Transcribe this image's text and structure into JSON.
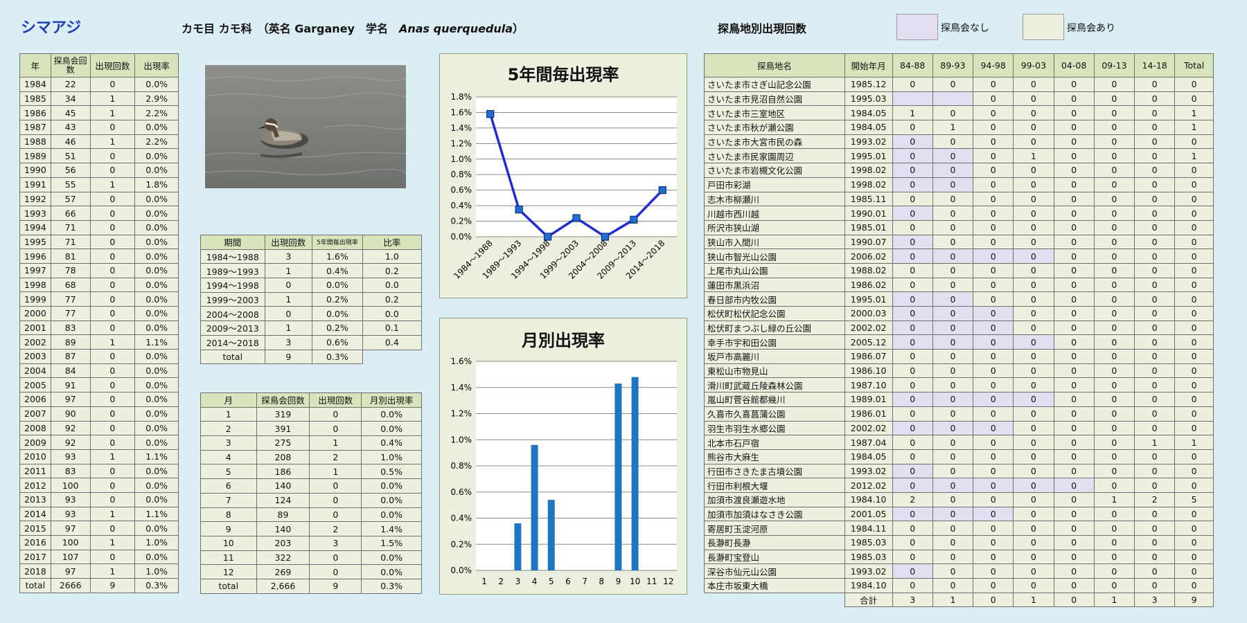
{
  "header": {
    "title": "シマアジ",
    "family": "カモ目 カモ科",
    "english_label": "（英名",
    "english_name": "Garganey",
    "scientific_label": "学名",
    "scientific_name": "Anas querquedula",
    "close_paren": "）",
    "site_heading": "探鳥地別出現回数",
    "legend_none": "探鳥会なし",
    "legend_yes": "探鳥会あり"
  },
  "colors": {
    "shade_none": "#e4dff0",
    "shade_yes": "#ebf1de",
    "series": "#1f2bd6",
    "bar": "#1f74c4",
    "title_blue": "#1f3fbf"
  },
  "year_table": {
    "headers": [
      "年",
      "探鳥会回数",
      "出現回数",
      "出現率"
    ],
    "rows": [
      [
        "1984",
        "22",
        "0",
        "0.0%"
      ],
      [
        "1985",
        "34",
        "1",
        "2.9%"
      ],
      [
        "1986",
        "45",
        "1",
        "2.2%"
      ],
      [
        "1987",
        "43",
        "0",
        "0.0%"
      ],
      [
        "1988",
        "46",
        "1",
        "2.2%"
      ],
      [
        "1989",
        "51",
        "0",
        "0.0%"
      ],
      [
        "1990",
        "56",
        "0",
        "0.0%"
      ],
      [
        "1991",
        "55",
        "1",
        "1.8%"
      ],
      [
        "1992",
        "57",
        "0",
        "0.0%"
      ],
      [
        "1993",
        "66",
        "0",
        "0.0%"
      ],
      [
        "1994",
        "71",
        "0",
        "0.0%"
      ],
      [
        "1995",
        "71",
        "0",
        "0.0%"
      ],
      [
        "1996",
        "81",
        "0",
        "0.0%"
      ],
      [
        "1997",
        "78",
        "0",
        "0.0%"
      ],
      [
        "1998",
        "68",
        "0",
        "0.0%"
      ],
      [
        "1999",
        "77",
        "0",
        "0.0%"
      ],
      [
        "2000",
        "77",
        "0",
        "0.0%"
      ],
      [
        "2001",
        "83",
        "0",
        "0.0%"
      ],
      [
        "2002",
        "89",
        "1",
        "1.1%"
      ],
      [
        "2003",
        "87",
        "0",
        "0.0%"
      ],
      [
        "2004",
        "84",
        "0",
        "0.0%"
      ],
      [
        "2005",
        "91",
        "0",
        "0.0%"
      ],
      [
        "2006",
        "97",
        "0",
        "0.0%"
      ],
      [
        "2007",
        "90",
        "0",
        "0.0%"
      ],
      [
        "2008",
        "92",
        "0",
        "0.0%"
      ],
      [
        "2009",
        "92",
        "0",
        "0.0%"
      ],
      [
        "2010",
        "93",
        "1",
        "1.1%"
      ],
      [
        "2011",
        "83",
        "0",
        "0.0%"
      ],
      [
        "2012",
        "100",
        "0",
        "0.0%"
      ],
      [
        "2013",
        "93",
        "0",
        "0.0%"
      ],
      [
        "2014",
        "93",
        "1",
        "1.1%"
      ],
      [
        "2015",
        "97",
        "0",
        "0.0%"
      ],
      [
        "2016",
        "100",
        "1",
        "1.0%"
      ],
      [
        "2017",
        "107",
        "0",
        "0.0%"
      ],
      [
        "2018",
        "97",
        "1",
        "1.0%"
      ]
    ],
    "total": [
      "total",
      "2666",
      "9",
      "0.3%"
    ]
  },
  "period_table": {
    "headers": [
      "期間",
      "出現回数",
      "5年間毎出現率",
      "比率"
    ],
    "rows": [
      [
        "1984～1988",
        "3",
        "1.6%",
        "1.0"
      ],
      [
        "1989～1993",
        "1",
        "0.4%",
        "0.2"
      ],
      [
        "1994～1998",
        "0",
        "0.0%",
        "0.0"
      ],
      [
        "1999～2003",
        "1",
        "0.2%",
        "0.2"
      ],
      [
        "2004～2008",
        "0",
        "0.0%",
        "0.0"
      ],
      [
        "2009～2013",
        "1",
        "0.2%",
        "0.1"
      ],
      [
        "2014～2018",
        "3",
        "0.6%",
        "0.4"
      ]
    ],
    "total": [
      "total",
      "9",
      "0.3%"
    ]
  },
  "month_table": {
    "headers": [
      "月",
      "探鳥会回数",
      "出現回数",
      "月別出現率"
    ],
    "rows": [
      [
        "1",
        "319",
        "0",
        "0.0%"
      ],
      [
        "2",
        "391",
        "0",
        "0.0%"
      ],
      [
        "3",
        "275",
        "1",
        "0.4%"
      ],
      [
        "4",
        "208",
        "2",
        "1.0%"
      ],
      [
        "5",
        "186",
        "1",
        "0.5%"
      ],
      [
        "6",
        "140",
        "0",
        "0.0%"
      ],
      [
        "7",
        "124",
        "0",
        "0.0%"
      ],
      [
        "8",
        "89",
        "0",
        "0.0%"
      ],
      [
        "9",
        "140",
        "2",
        "1.4%"
      ],
      [
        "10",
        "203",
        "3",
        "1.5%"
      ],
      [
        "11",
        "322",
        "0",
        "0.0%"
      ],
      [
        "12",
        "269",
        "0",
        "0.0%"
      ]
    ],
    "total": [
      "total",
      "2,666",
      "9",
      "0.3%"
    ]
  },
  "site_table": {
    "headers": [
      "探鳥地名",
      "開始年月",
      "84-88",
      "89-93",
      "94-98",
      "99-03",
      "04-08",
      "09-13",
      "14-18",
      "Total"
    ],
    "rows": [
      {
        "name": "さいたま市さぎ山記念公園",
        "start": "1985.12",
        "v": [
          "0",
          "0",
          "0",
          "0",
          "0",
          "0",
          "0",
          "0"
        ],
        "shade": []
      },
      {
        "name": "さいたま市見沼自然公園",
        "start": "1995.03",
        "v": [
          "",
          "",
          "0",
          "0",
          "0",
          "0",
          "0",
          "0"
        ],
        "shade": [
          0,
          1
        ]
      },
      {
        "name": "さいたま市三室地区",
        "start": "1984.05",
        "v": [
          "1",
          "0",
          "0",
          "0",
          "0",
          "0",
          "0",
          "1"
        ],
        "shade": []
      },
      {
        "name": "さいたま市秋が瀬公園",
        "start": "1984.05",
        "v": [
          "0",
          "1",
          "0",
          "0",
          "0",
          "0",
          "0",
          "1"
        ],
        "shade": []
      },
      {
        "name": "さいたま市大宮市民の森",
        "start": "1993.02",
        "v": [
          "0",
          "0",
          "0",
          "0",
          "0",
          "0",
          "0",
          "0"
        ],
        "shade": [
          0
        ]
      },
      {
        "name": "さいたま市民家園周辺",
        "start": "1995.01",
        "v": [
          "0",
          "0",
          "0",
          "1",
          "0",
          "0",
          "0",
          "1"
        ],
        "shade": [
          0,
          1
        ]
      },
      {
        "name": "さいたま市岩槻文化公園",
        "start": "1998.02",
        "v": [
          "0",
          "0",
          "0",
          "0",
          "0",
          "0",
          "0",
          "0"
        ],
        "shade": [
          0,
          1
        ]
      },
      {
        "name": "戸田市彩湖",
        "start": "1998.02",
        "v": [
          "0",
          "0",
          "0",
          "0",
          "0",
          "0",
          "0",
          "0"
        ],
        "shade": [
          0,
          1
        ]
      },
      {
        "name": "志木市柳瀬川",
        "start": "1985.11",
        "v": [
          "0",
          "0",
          "0",
          "0",
          "0",
          "0",
          "0",
          "0"
        ],
        "shade": []
      },
      {
        "name": "川越市西川越",
        "start": "1990.01",
        "v": [
          "0",
          "0",
          "0",
          "0",
          "0",
          "0",
          "0",
          "0"
        ],
        "shade": [
          0
        ]
      },
      {
        "name": "所沢市狭山湖",
        "start": "1985.01",
        "v": [
          "0",
          "0",
          "0",
          "0",
          "0",
          "0",
          "0",
          "0"
        ],
        "shade": []
      },
      {
        "name": "狭山市入間川",
        "start": "1990.07",
        "v": [
          "0",
          "0",
          "0",
          "0",
          "0",
          "0",
          "0",
          "0"
        ],
        "shade": [
          0
        ]
      },
      {
        "name": "狭山市智光山公園",
        "start": "2006.02",
        "v": [
          "0",
          "0",
          "0",
          "0",
          "0",
          "0",
          "0",
          "0"
        ],
        "shade": [
          0,
          1,
          2,
          3
        ]
      },
      {
        "name": "上尾市丸山公園",
        "start": "1988.02",
        "v": [
          "0",
          "0",
          "0",
          "0",
          "0",
          "0",
          "0",
          "0"
        ],
        "shade": []
      },
      {
        "name": "蓮田市黒浜沼",
        "start": "1986.02",
        "v": [
          "0",
          "0",
          "0",
          "0",
          "0",
          "0",
          "0",
          "0"
        ],
        "shade": []
      },
      {
        "name": "春日部市内牧公園",
        "start": "1995.01",
        "v": [
          "0",
          "0",
          "0",
          "0",
          "0",
          "0",
          "0",
          "0"
        ],
        "shade": [
          0,
          1
        ]
      },
      {
        "name": "松伏町松伏記念公園",
        "start": "2000.03",
        "v": [
          "0",
          "0",
          "0",
          "0",
          "0",
          "0",
          "0",
          "0"
        ],
        "shade": [
          0,
          1,
          2
        ]
      },
      {
        "name": "松伏町まつぶし緑の丘公園",
        "start": "2002.02",
        "v": [
          "0",
          "0",
          "0",
          "0",
          "0",
          "0",
          "0",
          "0"
        ],
        "shade": [
          0,
          1,
          2
        ]
      },
      {
        "name": "幸手市宇和田公園",
        "start": "2005.12",
        "v": [
          "0",
          "0",
          "0",
          "0",
          "0",
          "0",
          "0",
          "0"
        ],
        "shade": [
          0,
          1,
          2,
          3
        ]
      },
      {
        "name": "坂戸市高麗川",
        "start": "1986.07",
        "v": [
          "0",
          "0",
          "0",
          "0",
          "0",
          "0",
          "0",
          "0"
        ],
        "shade": []
      },
      {
        "name": "東松山市物見山",
        "start": "1986.10",
        "v": [
          "0",
          "0",
          "0",
          "0",
          "0",
          "0",
          "0",
          "0"
        ],
        "shade": []
      },
      {
        "name": "滑川町武蔵丘陵森林公園",
        "start": "1987.10",
        "v": [
          "0",
          "0",
          "0",
          "0",
          "0",
          "0",
          "0",
          "0"
        ],
        "shade": []
      },
      {
        "name": "嵐山町菅谷館都幾川",
        "start": "1989.01",
        "v": [
          "0",
          "0",
          "0",
          "0",
          "0",
          "0",
          "0",
          "0"
        ],
        "shade": [
          0,
          1,
          2,
          3
        ]
      },
      {
        "name": "久喜市久喜菖蒲公園",
        "start": "1986.01",
        "v": [
          "0",
          "0",
          "0",
          "0",
          "0",
          "0",
          "0",
          "0"
        ],
        "shade": []
      },
      {
        "name": "羽生市羽生水郷公園",
        "start": "2002.02",
        "v": [
          "0",
          "0",
          "0",
          "0",
          "0",
          "0",
          "0",
          "0"
        ],
        "shade": [
          0,
          1,
          2
        ]
      },
      {
        "name": "北本市石戸宿",
        "start": "1987.04",
        "v": [
          "0",
          "0",
          "0",
          "0",
          "0",
          "0",
          "1",
          "1"
        ],
        "shade": []
      },
      {
        "name": "熊谷市大麻生",
        "start": "1984.05",
        "v": [
          "0",
          "0",
          "0",
          "0",
          "0",
          "0",
          "0",
          "0"
        ],
        "shade": []
      },
      {
        "name": "行田市さきたま古墳公園",
        "start": "1993.02",
        "v": [
          "0",
          "0",
          "0",
          "0",
          "0",
          "0",
          "0",
          "0"
        ],
        "shade": [
          0
        ]
      },
      {
        "name": "行田市利根大堰",
        "start": "2012.02",
        "v": [
          "0",
          "0",
          "0",
          "0",
          "0",
          "0",
          "0",
          "0"
        ],
        "shade": [
          0,
          1,
          2,
          3,
          4
        ]
      },
      {
        "name": "加須市渡良瀬遊水地",
        "start": "1984.10",
        "v": [
          "2",
          "0",
          "0",
          "0",
          "0",
          "1",
          "2",
          "5"
        ],
        "shade": []
      },
      {
        "name": "加須市加須はなさき公園",
        "start": "2001.05",
        "v": [
          "0",
          "0",
          "0",
          "0",
          "0",
          "0",
          "0",
          "0"
        ],
        "shade": [
          0,
          1,
          2
        ]
      },
      {
        "name": "寄居町玉淀河原",
        "start": "1984.11",
        "v": [
          "0",
          "0",
          "0",
          "0",
          "0",
          "0",
          "0",
          "0"
        ],
        "shade": []
      },
      {
        "name": "長瀞町長瀞",
        "start": "1985.03",
        "v": [
          "0",
          "0",
          "0",
          "0",
          "0",
          "0",
          "0",
          "0"
        ],
        "shade": []
      },
      {
        "name": "長瀞町宝登山",
        "start": "1985.03",
        "v": [
          "0",
          "0",
          "0",
          "0",
          "0",
          "0",
          "0",
          "0"
        ],
        "shade": []
      },
      {
        "name": "深谷市仙元山公園",
        "start": "1993.02",
        "v": [
          "0",
          "0",
          "0",
          "0",
          "0",
          "0",
          "0",
          "0"
        ],
        "shade": [
          0
        ]
      },
      {
        "name": "本庄市坂東大橋",
        "start": "1984.10",
        "v": [
          "0",
          "0",
          "0",
          "0",
          "0",
          "0",
          "0",
          "0"
        ],
        "shade": []
      }
    ],
    "total_label": "合計",
    "totals": [
      "3",
      "1",
      "0",
      "1",
      "0",
      "1",
      "3",
      "9"
    ]
  },
  "chart_data": [
    {
      "type": "line",
      "title": "5年間毎出現率",
      "categories": [
        "1984～1988",
        "1989～1993",
        "1994～1998",
        "1999～2003",
        "2004～2008",
        "2009～2013",
        "2014～2018"
      ],
      "values": [
        1.58,
        0.35,
        0.0,
        0.24,
        0.0,
        0.22,
        0.6
      ],
      "ylim": [
        0,
        1.8
      ],
      "yticks": [
        "0.0%",
        "0.2%",
        "0.4%",
        "0.6%",
        "0.8%",
        "1.0%",
        "1.2%",
        "1.4%",
        "1.6%",
        "1.8%"
      ],
      "grid": true
    },
    {
      "type": "bar",
      "title": "月別出現率",
      "categories": [
        "1",
        "2",
        "3",
        "4",
        "5",
        "6",
        "7",
        "8",
        "9",
        "10",
        "11",
        "12"
      ],
      "values": [
        0,
        0,
        0.36,
        0.96,
        0.54,
        0,
        0,
        0,
        1.43,
        1.48,
        0,
        0
      ],
      "ylim": [
        0,
        1.6
      ],
      "yticks": [
        "0.0%",
        "0.2%",
        "0.4%",
        "0.6%",
        "0.8%",
        "1.0%",
        "1.2%",
        "1.4%",
        "1.6%"
      ],
      "grid": true
    }
  ]
}
